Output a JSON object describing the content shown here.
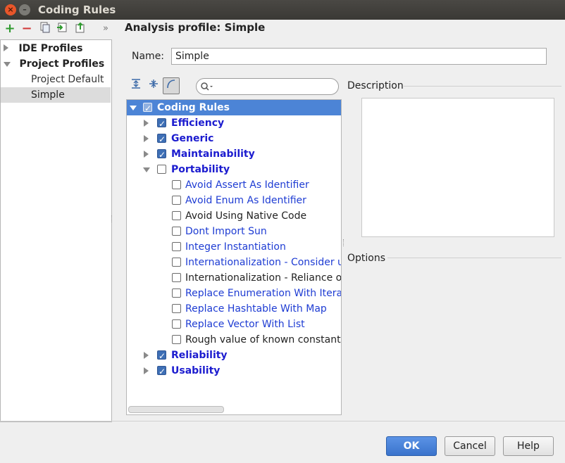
{
  "window": {
    "title": "Coding Rules"
  },
  "toolbar": {
    "add_icon": "plus-icon",
    "remove_icon": "minus-icon",
    "copy_icon": "copy-icon",
    "import_icon": "import-icon",
    "export_icon": "export-icon",
    "more_label": "»"
  },
  "profiles": {
    "ide": "IDE Profiles",
    "project": "Project Profiles",
    "items": [
      "Project Default",
      "Simple"
    ]
  },
  "main": {
    "heading": "Analysis profile: Simple",
    "name_label": "Name:",
    "name_value": "Simple",
    "description_label": "Description",
    "options_label": "Options"
  },
  "rules": {
    "root": "Coding Rules",
    "categories": {
      "efficiency": "Efficiency",
      "generic": "Generic",
      "maintainability": "Maintainability",
      "portability": "Portability",
      "reliability": "Reliability",
      "usability": "Usability"
    },
    "portability_items": [
      "Avoid Assert As Identifier",
      "Avoid Enum As Identifier",
      "Avoid Using Native Code",
      "Dont Import Sun",
      "Integer Instantiation",
      "Internationalization - Consider us",
      "Internationalization - Reliance on",
      "Replace Enumeration With Iterat",
      "Replace Hashtable With Map",
      "Replace Vector With List",
      "Rough value of known constant"
    ]
  },
  "buttons": {
    "ok": "OK",
    "cancel": "Cancel",
    "help": "Help"
  },
  "colors": {
    "selection": "#4c84d6",
    "primary_button": "#3a73cc",
    "link": "#1e3cd3"
  }
}
